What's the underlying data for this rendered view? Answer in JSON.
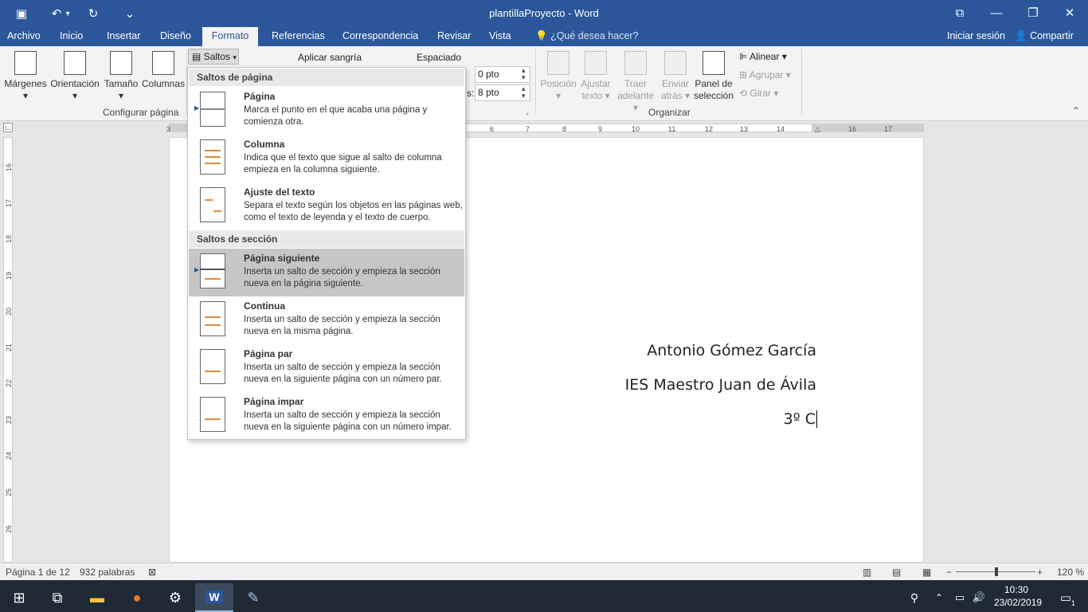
{
  "window": {
    "title": "plantillaProyecto - Word",
    "minimize_glyph": "—",
    "maximize_glyph": "❐",
    "close_glyph": "✕",
    "ribbon_display_glyph": "⧉"
  },
  "quick_access": {
    "save_glyph": "▣",
    "undo_glyph": "↶",
    "undo_arrow": "▾",
    "redo_glyph": "↻",
    "customize_glyph": "⌄"
  },
  "menu": {
    "tabs": [
      "Archivo",
      "Inicio",
      "Insertar",
      "Diseño",
      "Formato",
      "Referencias",
      "Correspondencia",
      "Revisar",
      "Vista"
    ],
    "active_tab": "Formato",
    "search_placeholder": "¿Qué desea hacer?",
    "signin": "Iniciar sesión",
    "share": "Compartir"
  },
  "ribbon": {
    "page_setup": {
      "buttons": [
        "Márgenes",
        "Orientación",
        "Tamaño",
        "Columnas"
      ],
      "saltos_label": "Saltos",
      "group_label": "Configurar página"
    },
    "paragraph": {
      "indent_label": "Aplicar sangría",
      "spacing_label": "Espaciado",
      "before_value": "0 pto",
      "after_label": "s:",
      "after_value": "8 pto"
    },
    "arrange": {
      "buttons": [
        {
          "line1": "Posición",
          "line2": "",
          "enabled": false
        },
        {
          "line1": "Ajustar",
          "line2": "texto",
          "enabled": false
        },
        {
          "line1": "Traer",
          "line2": "adelante",
          "enabled": false
        },
        {
          "line1": "Enviar",
          "line2": "atrás",
          "enabled": false
        },
        {
          "line1": "Panel de",
          "line2": "selección",
          "enabled": true
        }
      ],
      "align_label": "Alinear",
      "group_label": "Agrupar",
      "rotate_label": "Girar",
      "group_title": "Organizar"
    }
  },
  "ruler": {
    "top_ticks": [
      "3",
      "6",
      "7",
      "8",
      "9",
      "10",
      "11",
      "12",
      "13",
      "14",
      "15",
      "16",
      "17"
    ],
    "side_ticks": [
      "16",
      "17",
      "18",
      "19",
      "20",
      "21",
      "22",
      "23",
      "24",
      "25",
      "26"
    ]
  },
  "dropdown": {
    "page_breaks_header": "Saltos de página",
    "section_breaks_header": "Saltos de sección",
    "page_breaks": [
      {
        "title": "Página",
        "desc": "Marca el punto en el que acaba una página y comienza otra."
      },
      {
        "title": "Columna",
        "desc": "Indica que el texto que sigue al salto de columna empieza en la columna siguiente."
      },
      {
        "title": "Ajuste del texto",
        "desc": "Separa el texto según los objetos en las páginas web, como el texto de leyenda y el texto de cuerpo."
      }
    ],
    "section_breaks": [
      {
        "title": "Página siguiente",
        "desc": "Inserta un salto de sección y empieza la sección nueva en la página siguiente."
      },
      {
        "title": "Continua",
        "desc": "Inserta un salto de sección y empieza la sección nueva en la misma página."
      },
      {
        "title": "Página par",
        "desc": "Inserta un salto de sección y empieza la sección nueva en la siguiente página con un número par."
      },
      {
        "title": "Página impar",
        "desc": "Inserta un salto de sección y empieza la sección nueva en la siguiente página con un número impar."
      }
    ],
    "selected": "Página siguiente"
  },
  "document": {
    "lines": [
      "Antonio Gómez García",
      "IES Maestro Juan de Ávila",
      "3º C"
    ]
  },
  "status": {
    "page": "Página 1 de 12",
    "words": "932 palabras",
    "zoom": "120 %"
  },
  "taskbar": {
    "time": "10:30",
    "date": "23/02/2019",
    "notifications": "1"
  },
  "colors": {
    "accent": "#2b579a",
    "taskbar": "#1f2a36",
    "selected_item": "#c6c6c6"
  }
}
